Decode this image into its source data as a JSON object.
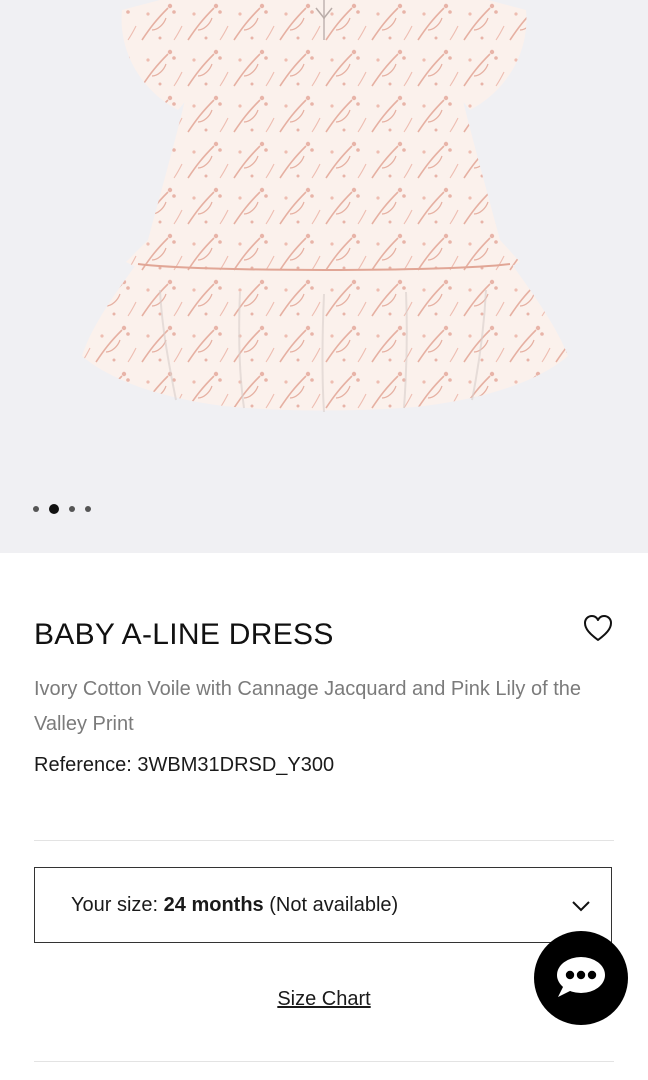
{
  "product": {
    "title": "BABY A-LINE DRESS",
    "description": "Ivory Cotton Voile with Cannage Jacquard and Pink Lily of the Valley Print",
    "reference": "Reference: 3WBM31DRSD_Y300"
  },
  "gallery": {
    "image_count": 4,
    "active_index": 1
  },
  "size": {
    "label": "Your size: ",
    "value": "24 months",
    "status": " (Not available)"
  },
  "links": {
    "size_chart": "Size Chart"
  },
  "icons": {
    "favorite": "heart-icon",
    "dropdown": "chevron-down-icon",
    "chat": "chat-bubble-icon"
  },
  "colors": {
    "gallery_bg": "#f0f0f3",
    "print": "#e8b4a8",
    "fabric": "#fbf1ec"
  }
}
